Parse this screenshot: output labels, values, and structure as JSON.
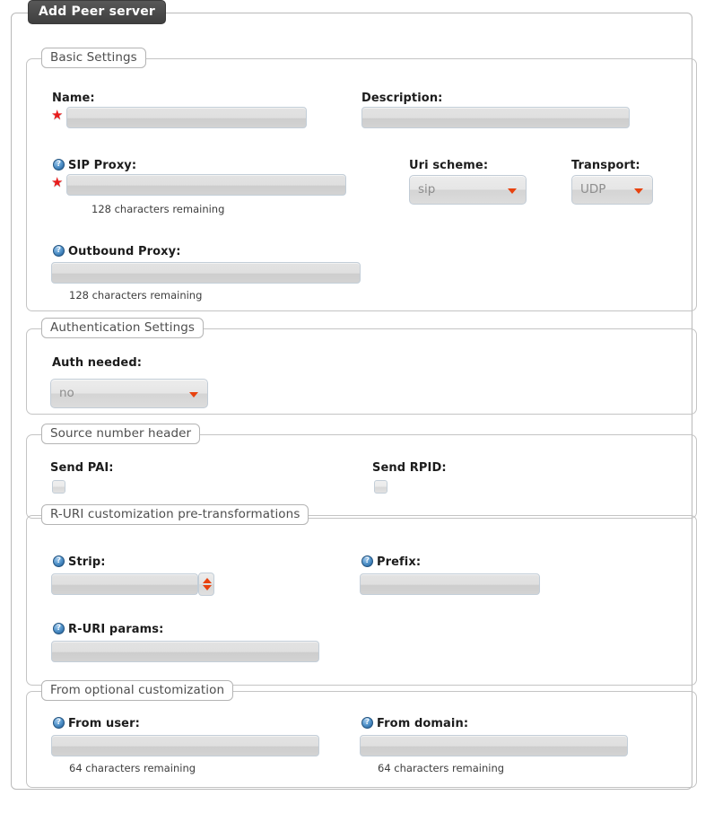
{
  "window": {
    "title": "Add Peer server"
  },
  "sections": {
    "basic": {
      "legend": "Basic Settings",
      "name": {
        "label": "Name:",
        "value": "",
        "placeholder": "",
        "required_marker": "★"
      },
      "description": {
        "label": "Description:",
        "value": "",
        "placeholder": ""
      },
      "sip_proxy": {
        "label": "SIP Proxy:",
        "value": "",
        "placeholder": "",
        "hint": "128 characters remaining",
        "required_marker": "★",
        "help_icon": "help-circle-icon"
      },
      "uri_scheme": {
        "label": "Uri scheme:",
        "value": "sip"
      },
      "transport": {
        "label": "Transport:",
        "value": "UDP"
      },
      "outbound_proxy": {
        "label": "Outbound Proxy:",
        "value": "",
        "placeholder": "",
        "hint": "128 characters remaining",
        "help_icon": "help-circle-icon"
      }
    },
    "auth": {
      "legend": "Authentication Settings",
      "auth_needed": {
        "label": "Auth needed:",
        "value": "no"
      }
    },
    "source_number_header": {
      "legend": "Source number header",
      "send_pai": {
        "label": "Send PAI:",
        "checked": false
      },
      "send_rpid": {
        "label": "Send RPID:",
        "checked": false
      }
    },
    "ruri": {
      "legend": "R-URI customization pre-transformations",
      "strip": {
        "label": "Strip:",
        "value": "",
        "help_icon": "help-circle-icon"
      },
      "prefix": {
        "label": "Prefix:",
        "value": "",
        "help_icon": "help-circle-icon"
      },
      "ruri_params": {
        "label": "R-URI params:",
        "value": "",
        "help_icon": "help-circle-icon"
      }
    },
    "from_optional": {
      "legend": "From optional customization",
      "from_user": {
        "label": "From user:",
        "value": "",
        "hint": "64 characters remaining",
        "help_icon": "help-circle-icon"
      },
      "from_domain": {
        "label": "From domain:",
        "value": "",
        "hint": "64 characters remaining",
        "help_icon": "help-circle-icon"
      }
    }
  },
  "colors": {
    "accent_arrow": "#e8420f",
    "required_star": "#e81c1c",
    "help_icon": "#2f6ea8",
    "legend_bar": "#4a4a4a"
  }
}
